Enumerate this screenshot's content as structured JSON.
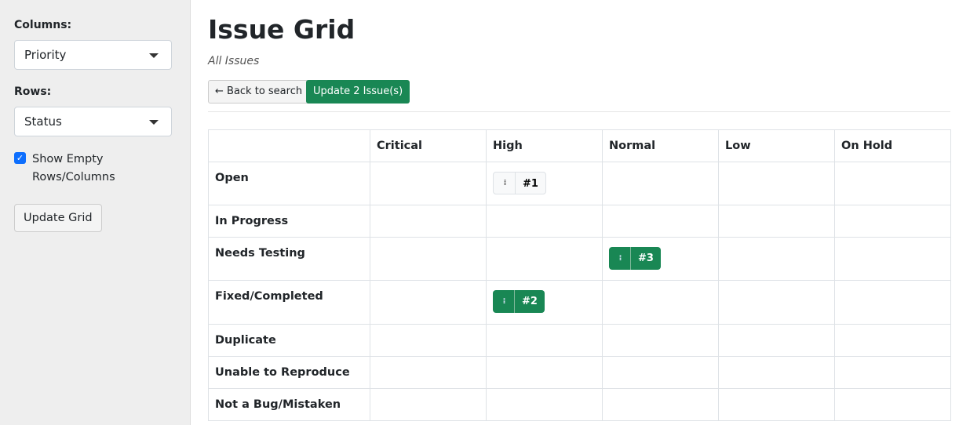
{
  "sidebar": {
    "columns_label": "Columns:",
    "columns_value": "Priority",
    "rows_label": "Rows:",
    "rows_value": "Status",
    "show_empty_label": "Show Empty Rows/Columns",
    "show_empty_checked": true,
    "update_grid": "Update Grid"
  },
  "main": {
    "title": "Issue Grid",
    "subtitle": "All Issues",
    "back_label": "← Back to search",
    "update_label": "Update 2 Issue(s)"
  },
  "grid": {
    "columns": [
      "Critical",
      "High",
      "Normal",
      "Low",
      "On Hold"
    ],
    "rows": [
      {
        "label": "Open",
        "cells": [
          [],
          [
            {
              "id": "#1",
              "style": "light"
            }
          ],
          [],
          [],
          []
        ]
      },
      {
        "label": "In Progress",
        "cells": [
          [],
          [],
          [],
          [],
          []
        ]
      },
      {
        "label": "Needs Testing",
        "cells": [
          [],
          [],
          [
            {
              "id": "#3",
              "style": "green"
            }
          ],
          [],
          []
        ]
      },
      {
        "label": "Fixed/Completed",
        "cells": [
          [],
          [
            {
              "id": "#2",
              "style": "green"
            }
          ],
          [],
          [],
          []
        ]
      },
      {
        "label": "Duplicate",
        "cells": [
          [],
          [],
          [],
          [],
          []
        ]
      },
      {
        "label": "Unable to Reproduce",
        "cells": [
          [],
          [],
          [],
          [],
          []
        ]
      },
      {
        "label": "Not a Bug/Mistaken",
        "cells": [
          [],
          [],
          [],
          [],
          []
        ]
      }
    ]
  },
  "colors": {
    "accent": "#198754",
    "checkbox": "#0d6efd"
  }
}
